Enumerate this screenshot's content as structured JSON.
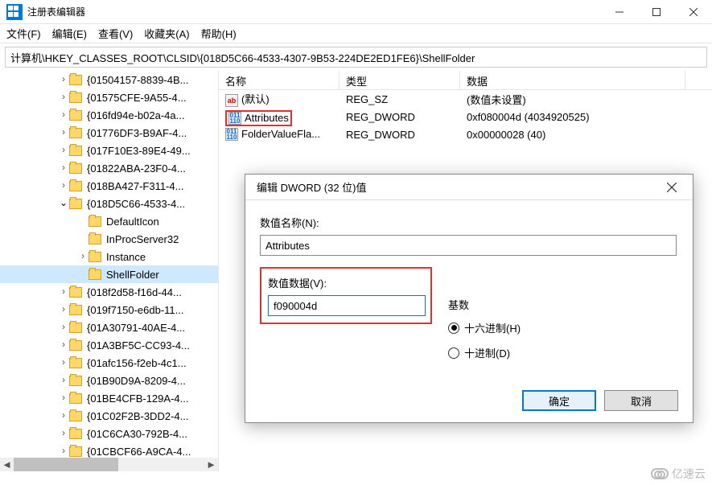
{
  "window": {
    "title": "注册表编辑器"
  },
  "menu": {
    "file": "文件(F)",
    "edit": "编辑(E)",
    "view": "查看(V)",
    "favorites": "收藏夹(A)",
    "help": "帮助(H)"
  },
  "address": "计算机\\HKEY_CLASSES_ROOT\\CLSID\\{018D5C66-4533-4307-9B53-224DE2ED1FE6}\\ShellFolder",
  "tree": {
    "items": [
      {
        "indent": 72,
        "chev": ">",
        "label": "{01504157-8839-4B..."
      },
      {
        "indent": 72,
        "chev": ">",
        "label": "{01575CFE-9A55-4..."
      },
      {
        "indent": 72,
        "chev": ">",
        "label": "{016fd94e-b02a-4a..."
      },
      {
        "indent": 72,
        "chev": ">",
        "label": "{01776DF3-B9AF-4..."
      },
      {
        "indent": 72,
        "chev": ">",
        "label": "{017F10E3-89E4-49..."
      },
      {
        "indent": 72,
        "chev": ">",
        "label": "{01822ABA-23F0-4..."
      },
      {
        "indent": 72,
        "chev": ">",
        "label": "{018BA427-F311-4..."
      },
      {
        "indent": 72,
        "chev": "v",
        "label": "{018D5C66-4533-4..."
      },
      {
        "indent": 96,
        "chev": "",
        "label": "DefaultIcon"
      },
      {
        "indent": 96,
        "chev": "",
        "label": "InProcServer32"
      },
      {
        "indent": 96,
        "chev": ">",
        "label": "Instance"
      },
      {
        "indent": 96,
        "chev": "",
        "label": "ShellFolder",
        "selected": true
      },
      {
        "indent": 72,
        "chev": ">",
        "label": "{018f2d58-f16d-44..."
      },
      {
        "indent": 72,
        "chev": ">",
        "label": "{019f7150-e6db-11..."
      },
      {
        "indent": 72,
        "chev": ">",
        "label": "{01A30791-40AE-4..."
      },
      {
        "indent": 72,
        "chev": ">",
        "label": "{01A3BF5C-CC93-4..."
      },
      {
        "indent": 72,
        "chev": ">",
        "label": "{01afc156-f2eb-4c1..."
      },
      {
        "indent": 72,
        "chev": ">",
        "label": "{01B90D9A-8209-4..."
      },
      {
        "indent": 72,
        "chev": ">",
        "label": "{01BE4CFB-129A-4..."
      },
      {
        "indent": 72,
        "chev": ">",
        "label": "{01C02F2B-3DD2-4..."
      },
      {
        "indent": 72,
        "chev": ">",
        "label": "{01C6CA30-792B-4..."
      },
      {
        "indent": 72,
        "chev": ">",
        "label": "{01CBCF66-A9CA-4..."
      }
    ]
  },
  "list": {
    "headers": {
      "name": "名称",
      "type": "类型",
      "data": "数据"
    },
    "rows": [
      {
        "icon": "ab",
        "name": "(默认)",
        "type": "REG_SZ",
        "data": "(数值未设置)"
      },
      {
        "icon": "bin",
        "name": "Attributes",
        "type": "REG_DWORD",
        "data": "0xf080004d (4034920525)",
        "highlight": true
      },
      {
        "icon": "bin",
        "name": "FolderValueFla...",
        "type": "REG_DWORD",
        "data": "0x00000028 (40)"
      }
    ]
  },
  "dialog": {
    "title": "编辑 DWORD (32 位)值",
    "name_label": "数值名称(N):",
    "name_value": "Attributes",
    "value_label": "数值数据(V):",
    "value_input": "f090004d",
    "base_label": "基数",
    "radio_hex": "十六进制(H)",
    "radio_dec": "十进制(D)",
    "ok": "确定",
    "cancel": "取消"
  },
  "watermark": "亿速云"
}
